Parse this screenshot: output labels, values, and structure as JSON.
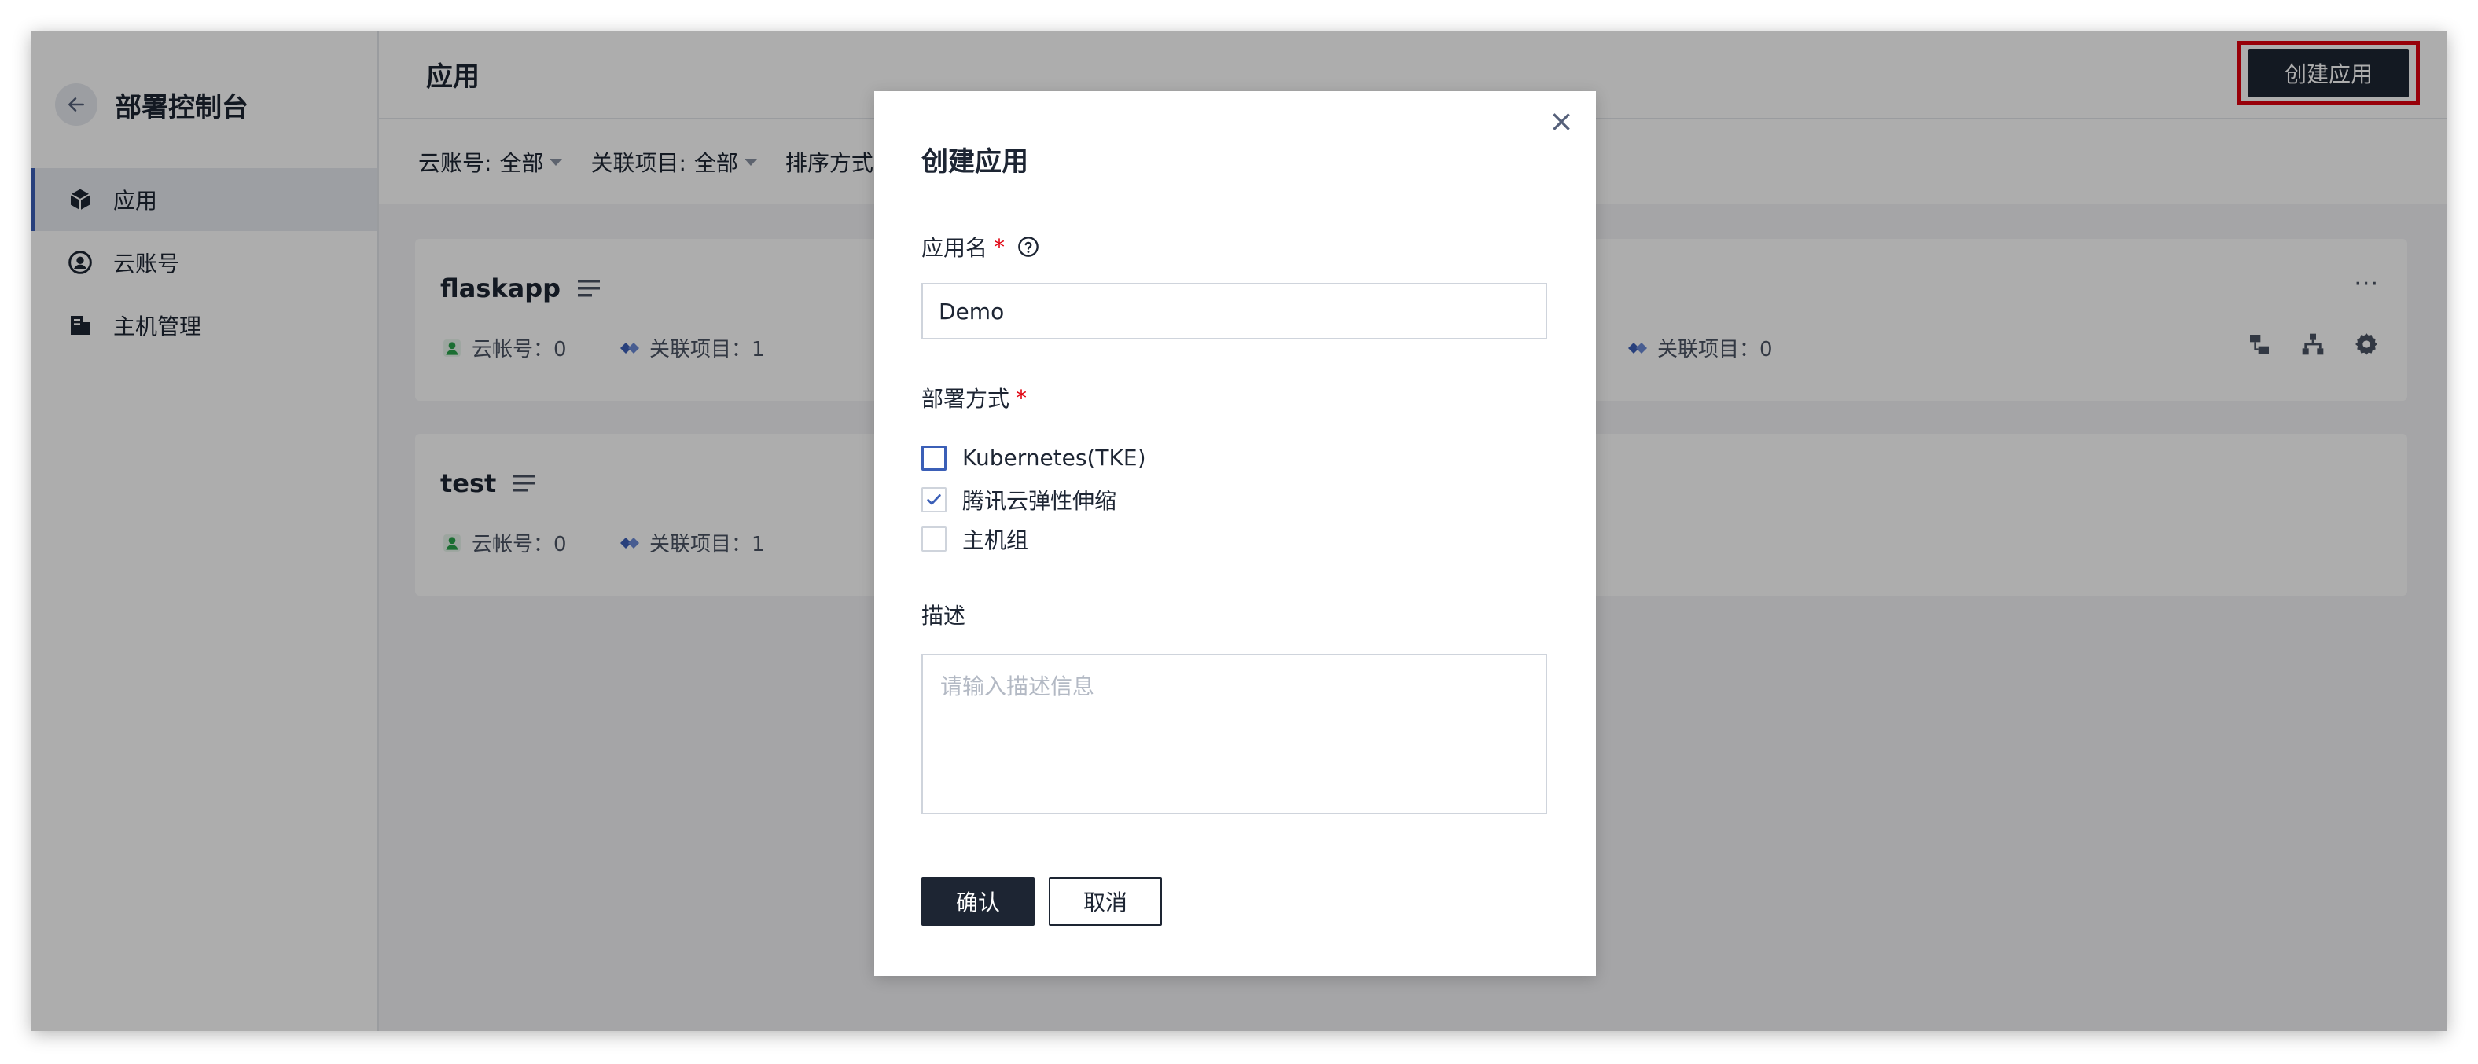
{
  "sidebar": {
    "title": "部署控制台",
    "items": [
      {
        "label": "应用",
        "icon": "cube-icon",
        "active": true
      },
      {
        "label": "云账号",
        "icon": "user-circle-icon",
        "active": false
      },
      {
        "label": "主机管理",
        "icon": "server-icon",
        "active": false
      }
    ]
  },
  "header": {
    "title": "应用",
    "create_label": "创建应用"
  },
  "filters": {
    "account_label": "云账号:",
    "account_value": "全部",
    "project_label": "关联项目:",
    "project_value": "全部",
    "sort_label": "排序方式"
  },
  "apps": [
    {
      "name": "flaskapp",
      "accounts": "云帐号：0",
      "projects": "关联项目：1",
      "right_projects": "关联项目：0"
    },
    {
      "name": "test",
      "accounts": "云帐号：0",
      "projects": "关联项目：1"
    }
  ],
  "dialog": {
    "title": "创建应用",
    "close_glyph": "×",
    "name_label": "应用名",
    "required_mark": "*",
    "name_value": "Demo",
    "deploy_label": "部署方式",
    "options": [
      {
        "label": "Kubernetes(TKE)",
        "checked": false
      },
      {
        "label": "腾讯云弹性伸缩",
        "checked": true
      },
      {
        "label": "主机组",
        "checked": false
      }
    ],
    "desc_label": "描述",
    "desc_placeholder": "请输入描述信息",
    "confirm_label": "确认",
    "cancel_label": "取消"
  },
  "colors": {
    "primary": "#1d2533",
    "accent": "#3b5fb7",
    "required": "#e0000e",
    "highlight_border": "#e0000e",
    "user_icon": "#29a34a"
  }
}
